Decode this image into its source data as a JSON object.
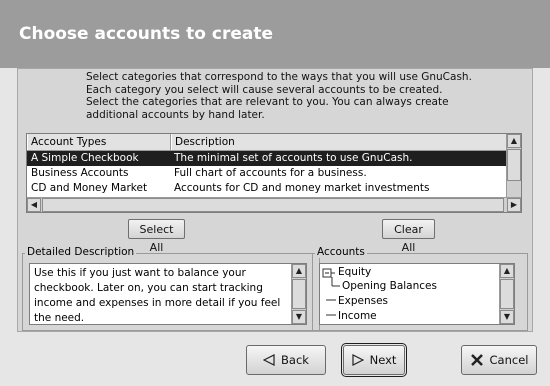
{
  "window": {
    "title": "Choose accounts to create"
  },
  "intro_lines": [
    "Select categories that correspond to the ways that you will use GnuCash.",
    "Each category you select will cause several accounts to be created.",
    "Select the categories that are relevant to you.  You can always create",
    "additional accounts by hand later."
  ],
  "account_table": {
    "columns": [
      "Account Types",
      "Description"
    ],
    "rows": [
      {
        "type": "A Simple Checkbook",
        "description": "The minimal set of accounts to use GnuCash.",
        "selected": true
      },
      {
        "type": "Business Accounts",
        "description": "Full chart of accounts for a business.",
        "selected": false
      },
      {
        "type": "CD and Money Market",
        "description": "Accounts for CD and money market investments",
        "selected": false
      }
    ]
  },
  "buttons": {
    "select_all": "Select All",
    "clear_all": "Clear All",
    "back": "Back",
    "next": "Next",
    "cancel": "Cancel"
  },
  "detailed_description": {
    "label": "Detailed Description",
    "lines": [
      "Use this if you just want to balance your",
      "checkbook. Later on, you can start tracking",
      "income and expenses in more detail if you feel",
      "the need."
    ]
  },
  "accounts_panel": {
    "label": "Accounts",
    "tree": [
      {
        "name": "Equity",
        "expander": "−"
      },
      {
        "name": "Opening Balances"
      },
      {
        "name": "Expenses"
      },
      {
        "name": "Income"
      }
    ]
  },
  "icons": {
    "back": "left-arrow-icon",
    "next": "right-arrow-icon",
    "cancel": "x-cancel-icon",
    "scroll_up": "scroll-up-icon",
    "scroll_down": "scroll-down-icon",
    "scroll_left": "scroll-left-icon",
    "scroll_right": "scroll-right-icon"
  },
  "colors": {
    "title_bg": "#9c9c9c",
    "selected_row_bg": "#1f1f1f",
    "panel_bg": "#d6d6d6"
  }
}
